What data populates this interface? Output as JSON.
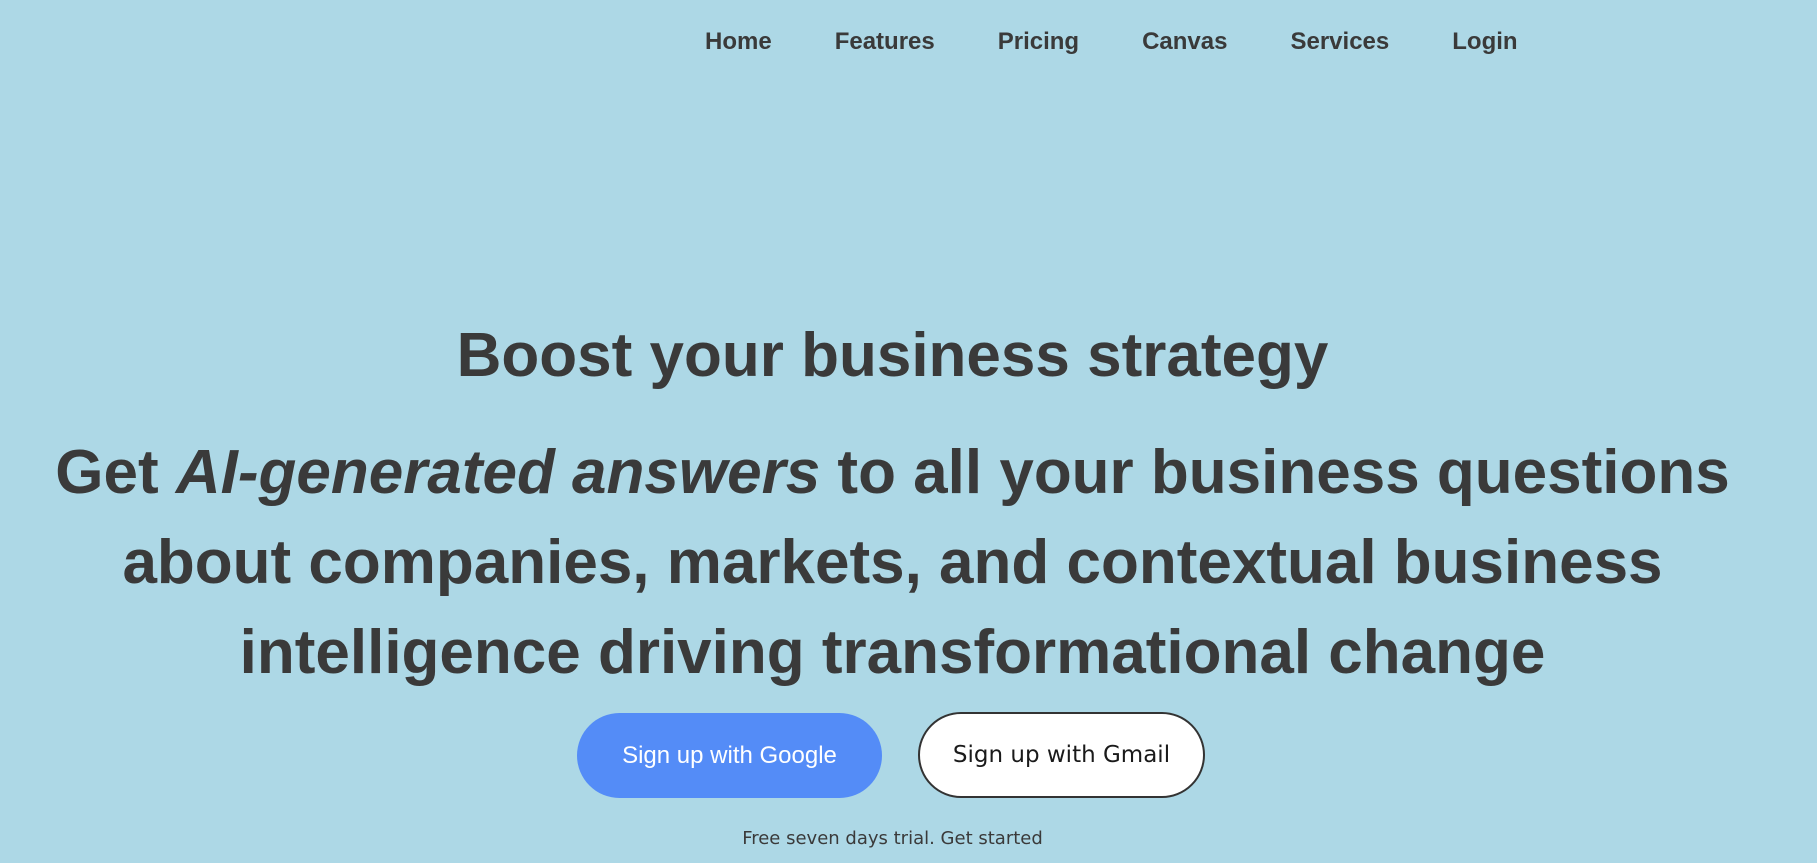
{
  "nav": {
    "items": [
      {
        "label": "Home"
      },
      {
        "label": "Features"
      },
      {
        "label": "Pricing"
      },
      {
        "label": "Canvas"
      },
      {
        "label": "Services"
      },
      {
        "label": "Login"
      }
    ]
  },
  "hero": {
    "title": "Boost your business strategy",
    "subtitle_prefix": "Get ",
    "subtitle_emphasis": "AI-generated answers",
    "subtitle_line1_rest": " to all your business questions",
    "subtitle_line2": "about companies, markets, and contextual business",
    "subtitle_line3": "intelligence driving transformational change"
  },
  "cta": {
    "google_label": "Sign up with Google",
    "gmail_label": "Sign up with Gmail",
    "trial_text": "Free seven days trial. Get started"
  },
  "colors": {
    "background": "#add8e6",
    "text": "#3a3a3a",
    "google_button": "#548cf7",
    "gmail_button": "#ffffff"
  }
}
